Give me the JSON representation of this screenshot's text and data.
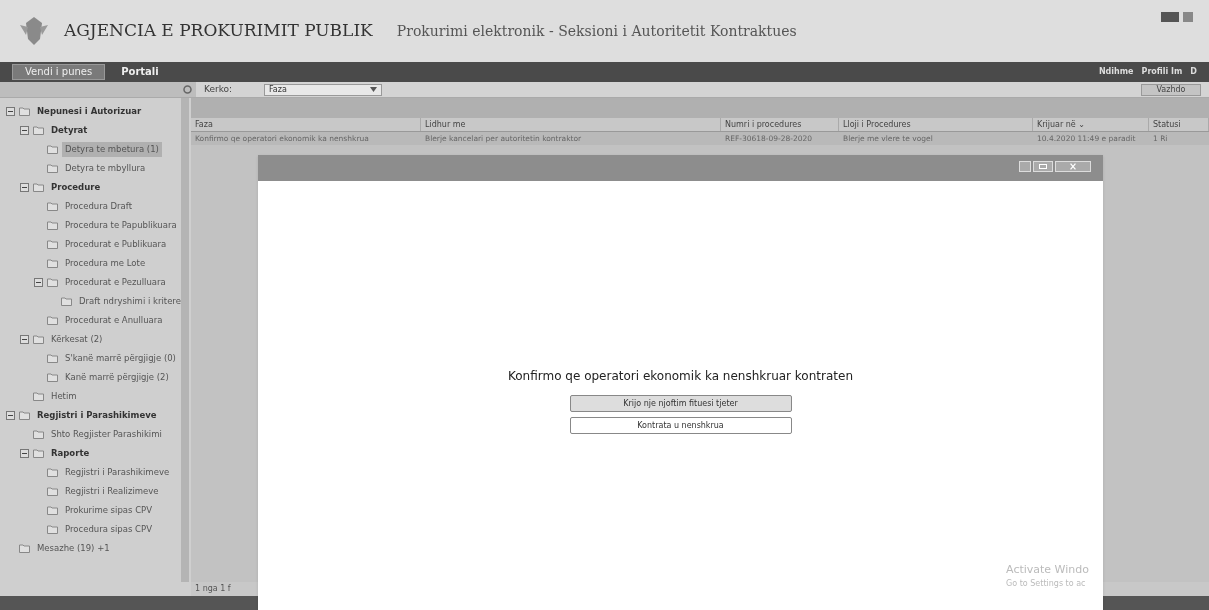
{
  "header": {
    "agency": "AGJENCIA E PROKURIMIT PUBLIK",
    "subtitle": "Prokurimi elektronik - Seksioni i Autoritetit Kontraktues"
  },
  "nav_tabs": [
    {
      "label": "Vendi i punes",
      "selected": true
    },
    {
      "label": "Portali",
      "selected": false
    }
  ],
  "nav_links": [
    "Ndihme",
    "Profili Im",
    "D"
  ],
  "search": {
    "label": "Kerko:",
    "value": "Faza",
    "button": "Vazhdo"
  },
  "sidebar": {
    "tree": [
      {
        "label": "Nepunesi i Autorizuar",
        "bold": true,
        "expanded": true,
        "children": [
          {
            "label": "Detyrat",
            "bold": true,
            "expanded": true,
            "children": [
              {
                "label": "Detyra te mbetura (1)",
                "selected": true
              },
              {
                "label": "Detyra te mbyllura",
                "selected": false
              }
            ]
          },
          {
            "label": "Procedure",
            "bold": true,
            "expanded": true,
            "children": [
              {
                "label": "Procedura Draft",
                "selected": false
              },
              {
                "label": "Procedura te Papublikuara",
                "selected": false
              },
              {
                "label": "Procedurat e Publikuara",
                "selected": false
              },
              {
                "label": "Procedura me Lote",
                "selected": false
              },
              {
                "label": "Procedurat e Pezulluara",
                "selected": false,
                "expanded": true,
                "children": [
                  {
                    "label": "Draft ndryshimi i kritere",
                    "selected": false
                  }
                ]
              },
              {
                "label": "Procedurat e Anulluara",
                "selected": false
              }
            ]
          },
          {
            "label": "Kërkesat (2)",
            "bold": false,
            "expanded": true,
            "children": [
              {
                "label": "S'kanë marrë përgjigje (0)",
                "selected": false
              },
              {
                "label": "Kanë marrë përgjigje (2)",
                "selected": false
              }
            ]
          },
          {
            "label": "Hetim",
            "selected": false
          }
        ]
      },
      {
        "label": "Regjistri i Parashikimeve",
        "bold": true,
        "expanded": true,
        "children": [
          {
            "label": "Shto Regjister Parashikimi",
            "selected": false
          },
          {
            "label": "Raporte",
            "bold": true,
            "expanded": true,
            "children": [
              {
                "label": "Regjistri i Parashikimeve",
                "selected": false
              },
              {
                "label": "Regjistri i Realizimeve",
                "selected": false
              },
              {
                "label": "Prokurime sipas CPV",
                "selected": false
              },
              {
                "label": "Procedura sipas CPV",
                "selected": false
              }
            ]
          }
        ]
      },
      {
        "label": "Mesazhe (19) +1",
        "selected": false
      }
    ]
  },
  "table": {
    "columns": [
      "Faza",
      "Lidhur me",
      "Numri i procedures",
      "Lloji i Procedures",
      "Krijuar në ⌄",
      "Statusi"
    ],
    "rows": [
      [
        "Konfirmo qe operatori ekonomik ka nenshkrua",
        "Blerje kancelari per autoritetin kontraktor",
        "REF-30618-09-28-2020",
        "Blerje me vlere te vogel",
        "10.4.2020 11:49 e paradit",
        "1 Ri"
      ]
    ]
  },
  "dialog": {
    "message": "Konfirmo qe operatori ekonomik ka nenshkruar kontraten",
    "buttons": [
      "Krijo nje njoftim fituesi tjeter",
      "Kontrata u nenshkrua"
    ]
  },
  "pager": "1 nga 1 f",
  "os_notice": [
    "Activate Windo",
    "Go to Settings to ac"
  ]
}
